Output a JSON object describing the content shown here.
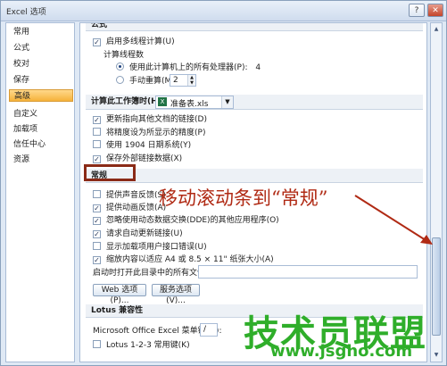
{
  "window": {
    "title": "Excel 选项",
    "help": "?",
    "close": "✕"
  },
  "sidebar": {
    "items": [
      {
        "label": "常用"
      },
      {
        "label": "公式"
      },
      {
        "label": "校对"
      },
      {
        "label": "保存"
      },
      {
        "label": "高级",
        "active": true
      },
      {
        "label": "自定义"
      },
      {
        "label": "加载项"
      },
      {
        "label": "信任中心"
      },
      {
        "label": "资源"
      }
    ]
  },
  "content": {
    "section_top": "公式",
    "multithread": {
      "label": "启用多线程计算(U)",
      "checked": true
    },
    "threads_label": "计算线程数",
    "use_all_cpu": {
      "label": "使用此计算机上的所有处理器(P):",
      "value": "4",
      "selected": true
    },
    "manual": {
      "label": "手动重算(M)",
      "value": "2",
      "selected": false
    },
    "workbook_calc": {
      "label": "计算此工作簿时(H):",
      "file": "准备表.xls",
      "icon": "excel-file-icon"
    },
    "wb_options": [
      {
        "label": "更新指向其他文档的链接(D)",
        "checked": true
      },
      {
        "label": "将精度设为所显示的精度(P)",
        "checked": false
      },
      {
        "label": "使用 1904 日期系统(Y)",
        "checked": false
      },
      {
        "label": "保存外部链接数据(X)",
        "checked": true
      }
    ],
    "section_general": "常规",
    "general_options": [
      {
        "label": "提供声音反馈(S)",
        "checked": false
      },
      {
        "label": "提供动画反馈(A)",
        "checked": true
      },
      {
        "label": "忽略使用动态数据交换(DDE)的其他应用程序(O)",
        "checked": true
      },
      {
        "label": "请求自动更新链接(U)",
        "checked": true
      },
      {
        "label": "显示加载项用户接口错误(U)",
        "checked": false
      },
      {
        "label": "缩放内容以适应 A4 或 8.5 × 11\" 纸张大小(A)",
        "checked": true
      }
    ],
    "startup_label": "启动时打开此目录中的所有文件(L):",
    "startup_value": "",
    "web_button": "Web 选项(P)...",
    "service_button": "服务选项(V)...",
    "section_lotus": "Lotus 兼容性",
    "lotus_menu_key": {
      "label": "Microsoft Office Excel 菜单键(M):",
      "value": "/"
    },
    "lotus_nav": {
      "label": "Lotus 1-2-3 常用键(K)",
      "checked": false
    }
  },
  "annotation": {
    "text": "移动滚动条到“常规”",
    "color": "#b02a14"
  },
  "watermark": {
    "text": "技术员联盟",
    "url": "www.jsgho.com",
    "color": "#2fae2a"
  },
  "scrollbar": {
    "position_fraction": 0.65
  }
}
